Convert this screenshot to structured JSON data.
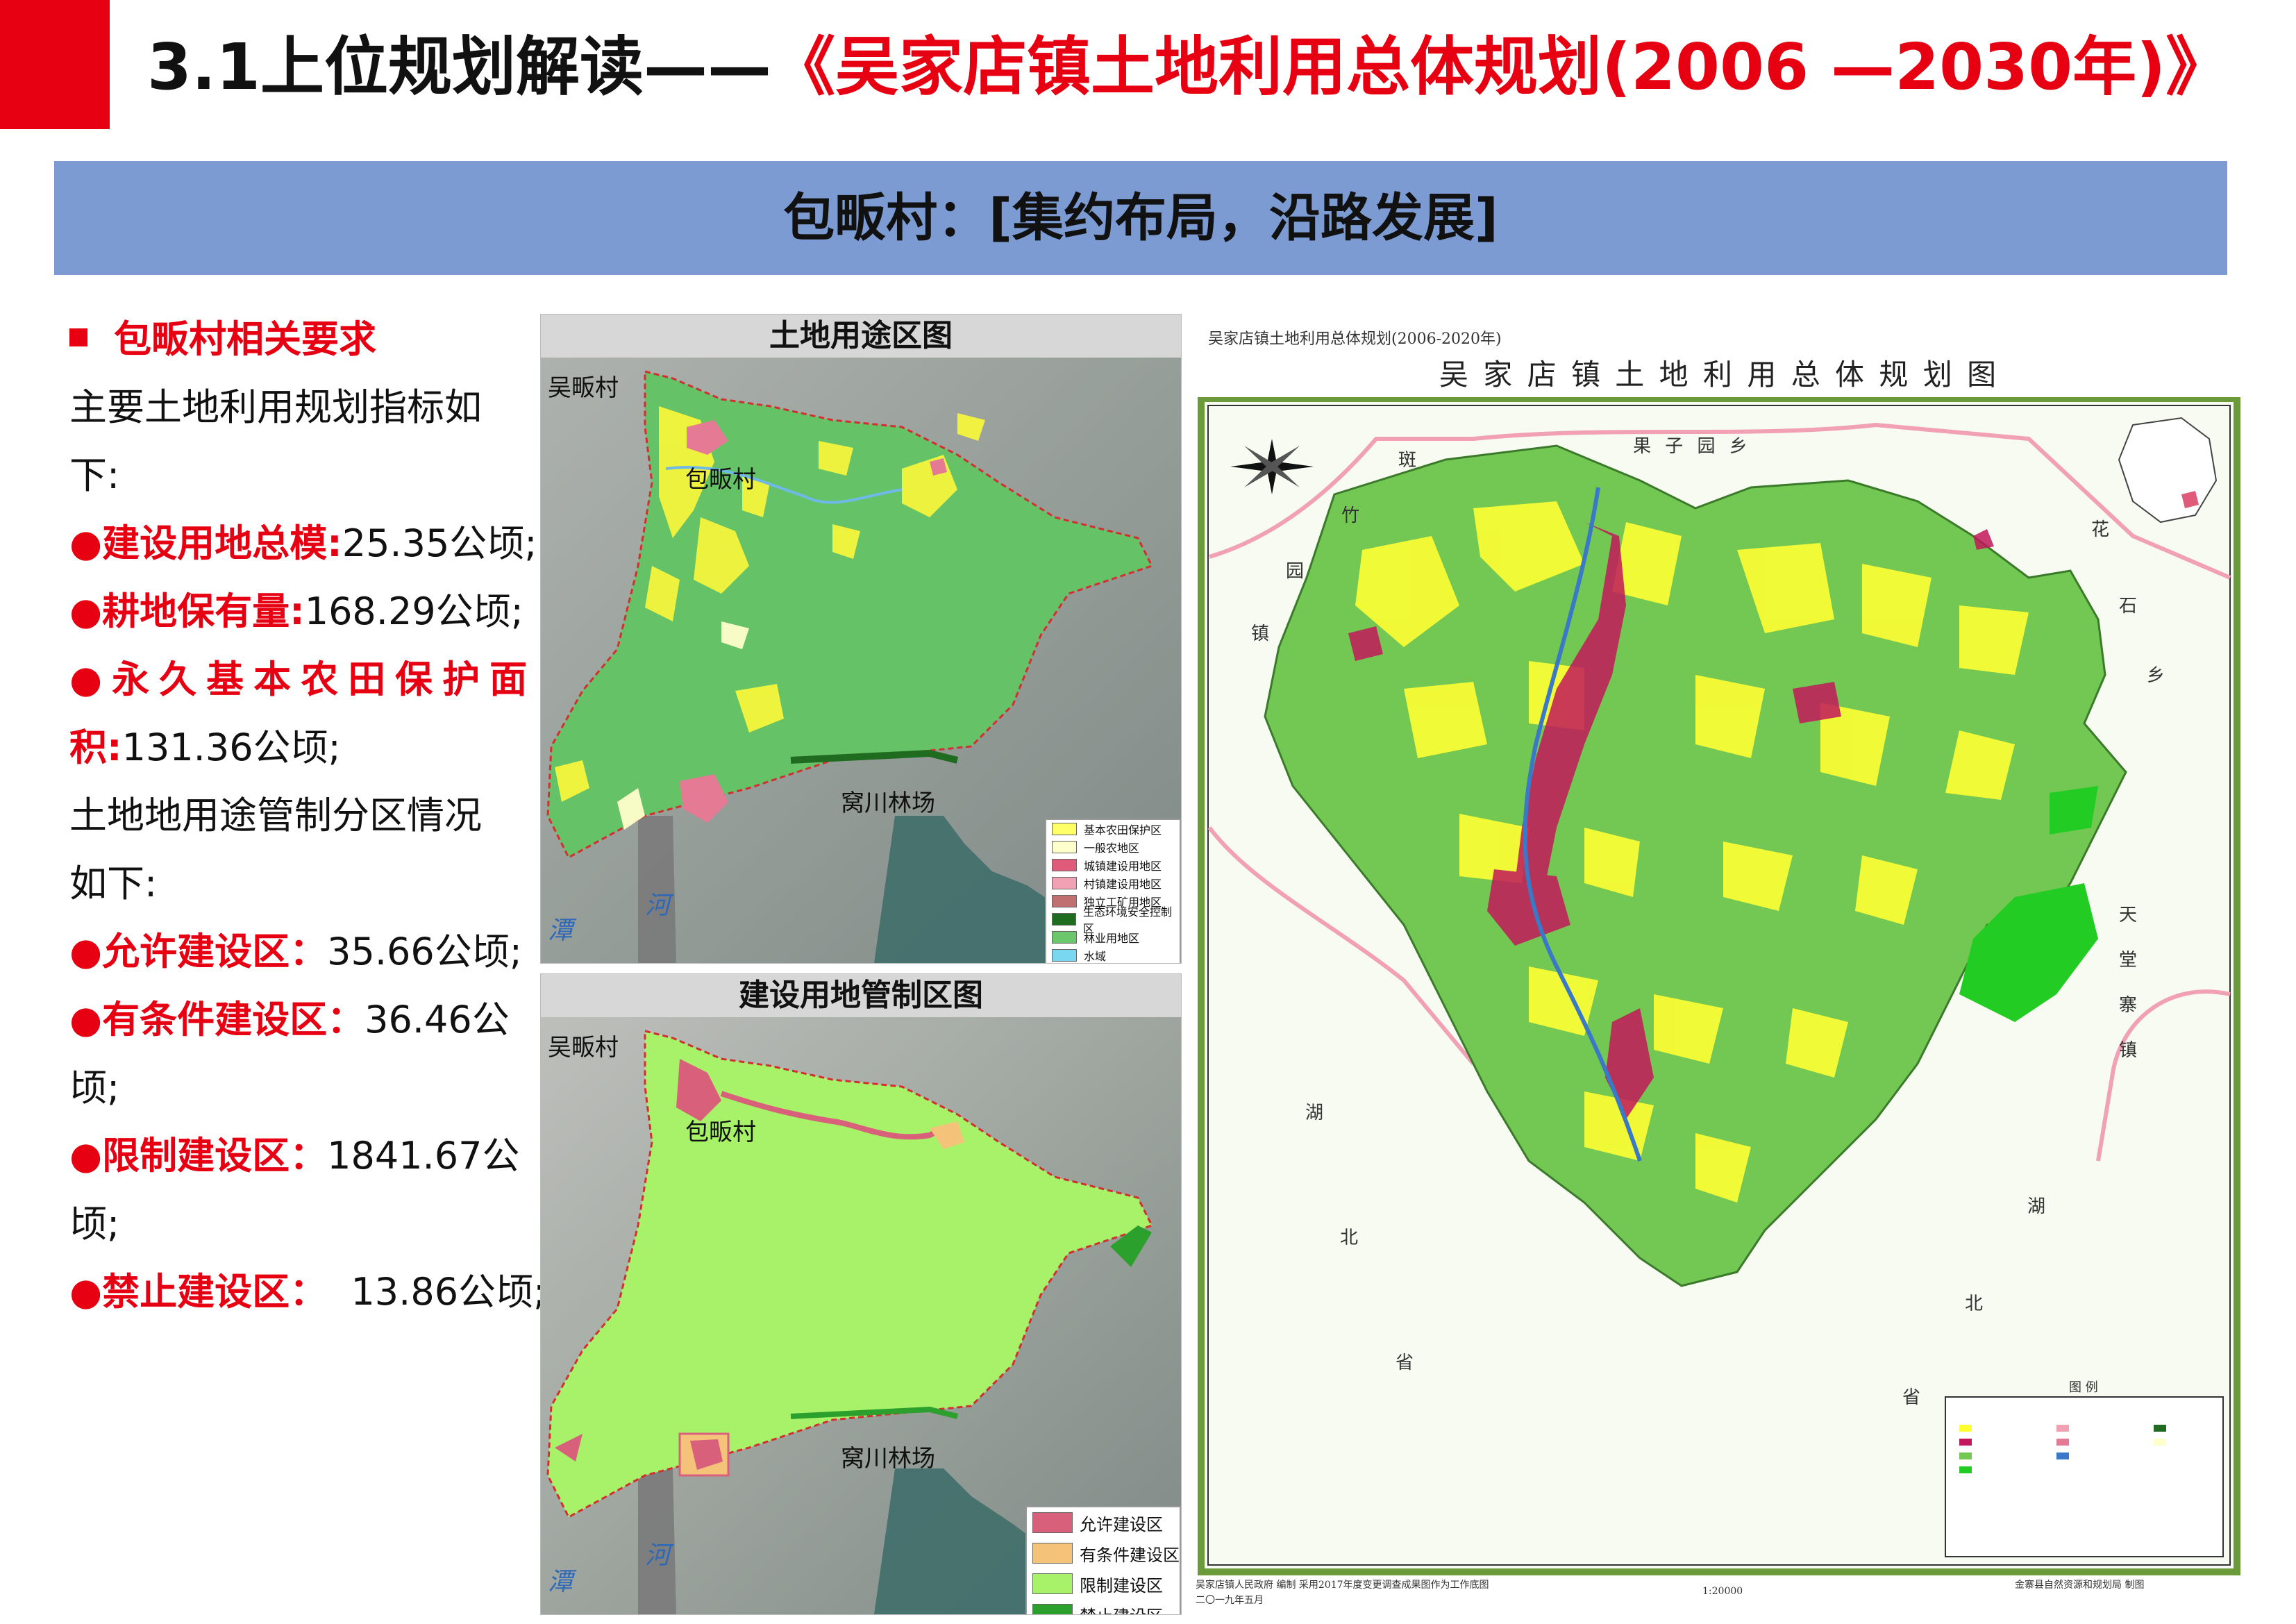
{
  "header": {
    "title_part1": "3.1上位规划解读——",
    "title_part2": "《吴家店镇土地利用总体规划(2006 —2030年)》",
    "subtitle_village": "包畈村：",
    "subtitle_tag": "[集约布局，沿路发展]"
  },
  "left": {
    "heading": "包畈村相关要求",
    "intro": [
      "主要土地利用规划指标如",
      "下:"
    ],
    "items1": [
      {
        "label": "●建设用地总模:",
        "value": "25.35公顷;"
      },
      {
        "label": "●耕地保有量:",
        "value": "168.29公顷;"
      }
    ],
    "item3_label_line1": "●永久基本农田保护面",
    "item3_label_line2": "积:",
    "item3_value": "131.36公顷;",
    "intro2": [
      "土地地用途管制分区情况",
      "如下:"
    ],
    "items2": [
      {
        "label": "●允许建设区：",
        "value": "35.66公顷;"
      },
      {
        "label": "●有条件建设区：",
        "value": "36.46公",
        "cont": "顷;"
      },
      {
        "label": "●限制建设区：",
        "value": "1841.67公",
        "cont": "顷;"
      },
      {
        "label": "●禁止建设区：",
        "value": "  13.86公顷;"
      }
    ]
  },
  "panel1": {
    "title": "土地用途区图",
    "place_village_top": "吴畈村",
    "place_village": "包畈村",
    "place_forest": "窝川林场",
    "river_1": "潭",
    "river_2": "河",
    "legend": [
      {
        "label": "基本农田保护区",
        "color": "#ffff66"
      },
      {
        "label": "一般农地区",
        "color": "#ffffcc"
      },
      {
        "label": "城镇建设用地区",
        "color": "#e05a7a"
      },
      {
        "label": "村镇建设用地区",
        "color": "#f2a0b4"
      },
      {
        "label": "独立工矿用地区",
        "color": "#c07070"
      },
      {
        "label": "生态环境安全控制区",
        "color": "#1f6b1f"
      },
      {
        "label": "林业用地区",
        "color": "#6cc66c"
      },
      {
        "label": "水域",
        "color": "#7ad7f0"
      }
    ]
  },
  "panel2": {
    "title": "建设用地管制区图",
    "place_village_top": "吴畈村",
    "place_village": "包畈村",
    "place_forest": "窝川林场",
    "river_1": "潭",
    "river_2": "河",
    "legend": [
      {
        "label": "允许建设区",
        "color": "#d9607a"
      },
      {
        "label": "有条件建设区",
        "color": "#f5c27a"
      },
      {
        "label": "限制建设区",
        "color": "#a8f26a"
      },
      {
        "label": "禁止建设区",
        "color": "#2ca02c"
      }
    ]
  },
  "right_map": {
    "small_title": "吴家店镇土地利用总体规划(2006-2020年)",
    "main_title": "吴 家 店 镇 土 地 利 用 总 体 规 划 图",
    "labels_top": [
      "斑",
      "果  子  园  乡"
    ],
    "labels_left": [
      "竹",
      "园",
      "镇"
    ],
    "labels_right": [
      "花",
      "石",
      "乡"
    ],
    "labels_right2": [
      "天",
      "堂",
      "寨",
      "镇"
    ],
    "labels_bottom_left": [
      "湖",
      "北",
      "省"
    ],
    "labels_bottom_right": [
      "湖",
      "北",
      "省"
    ],
    "legend_title": "图  例",
    "scale": "1:20000",
    "footer_left": "吴家店镇人民政府  编制   采用2017年度变更调查成果图作为工作底图",
    "footer_date": "二〇一九年五月",
    "footer_right": "金寨县自然资源和规划局  制图"
  }
}
